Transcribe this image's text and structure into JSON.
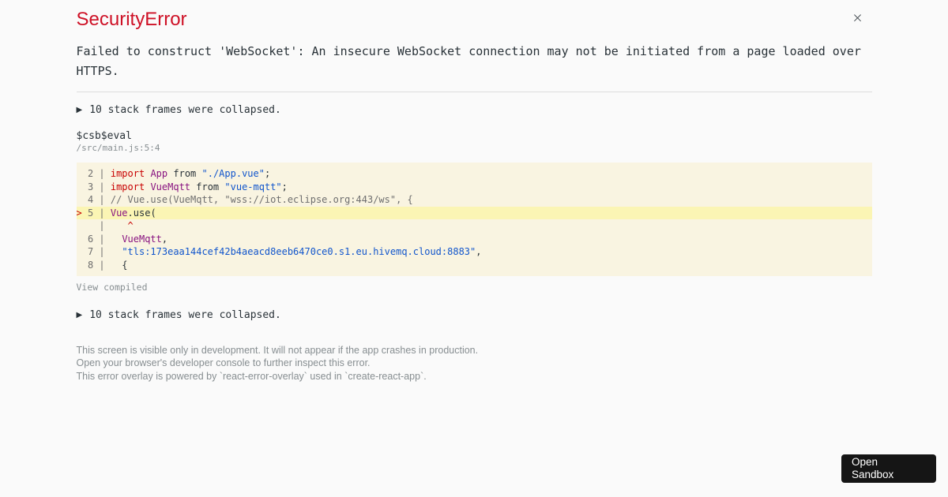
{
  "header": {
    "title": "SecurityError",
    "close_icon": "×"
  },
  "message": "Failed to construct 'WebSocket': An insecure WebSocket connection may not be initiated from a page loaded over HTTPS.",
  "stack": {
    "collapsed_label_top": "10 stack frames were collapsed.",
    "collapsed_label_bottom": "10 stack frames were collapsed.",
    "triangle_icon": "▶",
    "frame_function": "$csb$eval",
    "frame_location": "/src/main.js:5:4",
    "view_compiled_label": "View compiled",
    "code_frame": {
      "lines": [
        {
          "highlight": false,
          "tokens": [
            {
              "type": "gut",
              "text": "  2 | "
            },
            {
              "type": "kw",
              "text": "import"
            },
            {
              "type": "plain",
              "text": " "
            },
            {
              "type": "cap",
              "text": "App"
            },
            {
              "type": "plain",
              "text": " from "
            },
            {
              "type": "str",
              "text": "\"./App.vue\""
            },
            {
              "type": "plain",
              "text": ";"
            }
          ]
        },
        {
          "highlight": false,
          "tokens": [
            {
              "type": "gut",
              "text": "  3 | "
            },
            {
              "type": "kw",
              "text": "import"
            },
            {
              "type": "plain",
              "text": " "
            },
            {
              "type": "cap",
              "text": "VueMqtt"
            },
            {
              "type": "plain",
              "text": " from "
            },
            {
              "type": "str",
              "text": "\"vue-mqtt\""
            },
            {
              "type": "plain",
              "text": ";"
            }
          ]
        },
        {
          "highlight": false,
          "tokens": [
            {
              "type": "gut",
              "text": "  4 | "
            },
            {
              "type": "com",
              "text": "// Vue.use(VueMqtt, \"wss://iot.eclipse.org:443/ws\", {"
            }
          ]
        },
        {
          "highlight": true,
          "tokens": [
            {
              "type": "mark",
              "text": "> "
            },
            {
              "type": "gut",
              "text": "5 | "
            },
            {
              "type": "cap",
              "text": "Vue"
            },
            {
              "type": "plain",
              "text": ".use("
            }
          ]
        },
        {
          "highlight": false,
          "tokens": [
            {
              "type": "gut",
              "text": "    | "
            },
            {
              "type": "plain",
              "text": "   "
            },
            {
              "type": "mark",
              "text": "^"
            }
          ]
        },
        {
          "highlight": false,
          "tokens": [
            {
              "type": "gut",
              "text": "  6 | "
            },
            {
              "type": "plain",
              "text": "  "
            },
            {
              "type": "cap",
              "text": "VueMqtt"
            },
            {
              "type": "plain",
              "text": ","
            }
          ]
        },
        {
          "highlight": false,
          "tokens": [
            {
              "type": "gut",
              "text": "  7 | "
            },
            {
              "type": "plain",
              "text": "  "
            },
            {
              "type": "str",
              "text": "\"tls:173eaa144cef42b4aeacd8eeb6470ce0.s1.eu.hivemq.cloud:8883\""
            },
            {
              "type": "plain",
              "text": ","
            }
          ]
        },
        {
          "highlight": false,
          "tokens": [
            {
              "type": "gut",
              "text": "  8 | "
            },
            {
              "type": "plain",
              "text": "  {"
            }
          ]
        }
      ]
    }
  },
  "footer": {
    "line1": "This screen is visible only in development. It will not appear if the app crashes in production.",
    "line2": "Open your browser's developer console to further inspect this error.",
    "line3": "This error overlay is powered by `react-error-overlay` used in `create-react-app`."
  },
  "sandbox_button": {
    "label": "Open Sandbox"
  },
  "colors": {
    "page_background": "#fafafa",
    "error_title": "#ce1126",
    "text_primary": "#293238",
    "text_secondary": "#878e91",
    "divider": "#dddddd",
    "code_background": "#f9f4e1",
    "code_highlight_row": "#fbf5b4",
    "syntax_keyword": "#c80000",
    "syntax_capitalized": "#881280",
    "syntax_string": "#1155cc",
    "syntax_comment": "#6e6e6e",
    "syntax_gutter": "#6e6e6e",
    "sandbox_button_background": "#151515",
    "sandbox_button_text": "#ffffff"
  }
}
